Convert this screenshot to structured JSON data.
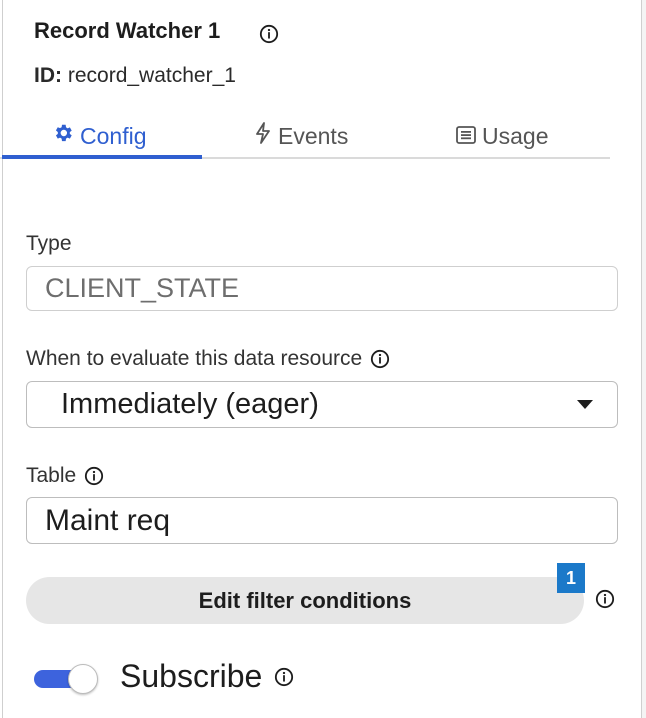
{
  "header": {
    "title": "Record Watcher 1",
    "id_label": "ID:",
    "id_value": "record_watcher_1"
  },
  "tabs": [
    {
      "label": "Config",
      "icon": "gear-icon",
      "active": true
    },
    {
      "label": "Events",
      "icon": "lightning-icon",
      "active": false
    },
    {
      "label": "Usage",
      "icon": "list-icon",
      "active": false
    }
  ],
  "type": {
    "label": "Type",
    "value": "CLIENT_STATE"
  },
  "evaluate": {
    "label": "When to evaluate this data resource",
    "selected": "Immediately (eager)"
  },
  "table": {
    "label": "Table",
    "value": "Maint req"
  },
  "filter": {
    "button_label": "Edit filter conditions",
    "badge_count": "1"
  },
  "subscribe": {
    "label": "Subscribe",
    "enabled": true
  },
  "colors": {
    "accent": "#2f5fd0",
    "badge": "#1b79c9",
    "toggle_on": "#3d63dd"
  }
}
